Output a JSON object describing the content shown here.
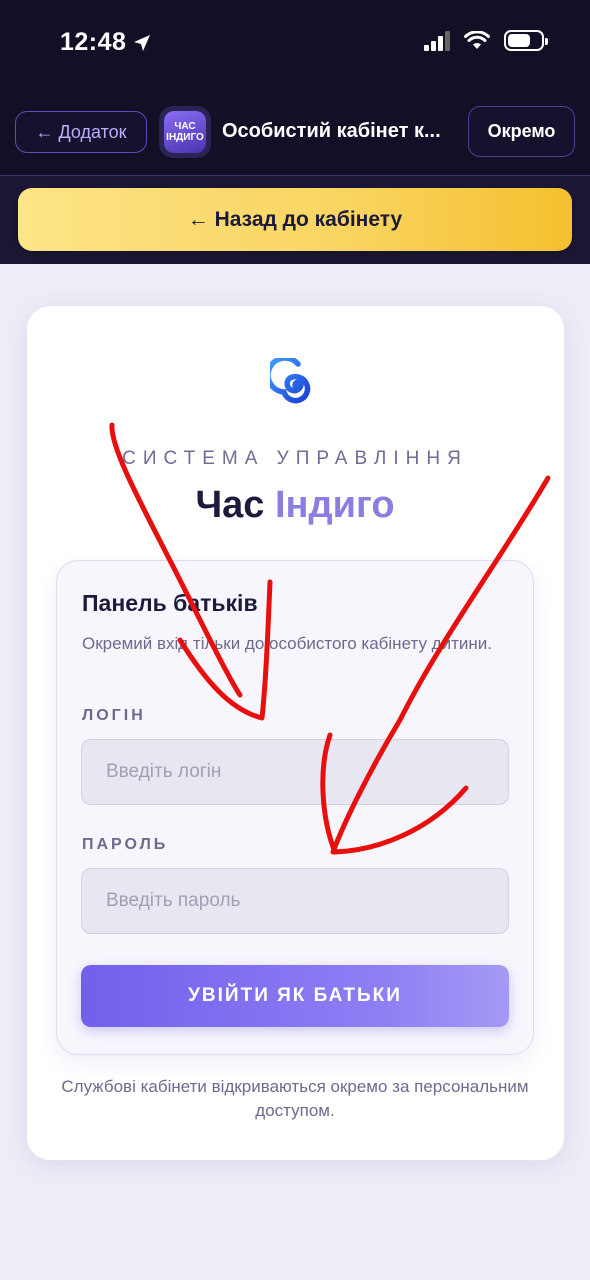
{
  "status_bar": {
    "time": "12:48"
  },
  "header": {
    "back_app_label": "← Додаток",
    "app_icon_line1": "ЧАС",
    "app_icon_line2": "ІНДИГО",
    "title": "Особистий кабінет к...",
    "open_separately_label": "Окремо"
  },
  "back_cabinet_label": "← Назад до кабінету",
  "brand": {
    "system_label": "Система управління",
    "name_part1": "Час",
    "name_part2": "Індиго"
  },
  "panel": {
    "title": "Панель батьків",
    "description": "Окремий вхід тільки до особистого кабінету дитини.",
    "login_label": "ЛОГІН",
    "login_placeholder": "Введіть логін",
    "password_label": "ПАРОЛЬ",
    "password_placeholder": "Введіть пароль",
    "submit_label": "УВІЙТИ ЯК БАТЬКИ"
  },
  "footnote": "Службові кабінети відкриваються окремо за персональним доступом.",
  "colors": {
    "header_bg": "#120f26",
    "accent_yellow": "#f9d460",
    "accent_purple": "#7160ec",
    "brand_light": "#8a7fe0",
    "annotation_red": "#e8100e"
  }
}
